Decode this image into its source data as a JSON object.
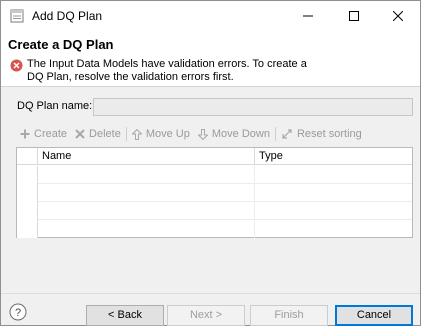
{
  "window": {
    "title": "Add DQ Plan",
    "controls": {
      "minimize_icon": "minimize-icon",
      "maximize_icon": "maximize-icon",
      "close_icon": "close-icon"
    }
  },
  "header": {
    "page_title": "Create a DQ Plan",
    "error_message": "The Input Data Models have validation errors. To create a DQ Plan, resolve the validation errors first.",
    "error_icon": "error-icon"
  },
  "form": {
    "name_label": "DQ Plan name:",
    "name_value": ""
  },
  "toolbar": {
    "items": [
      {
        "label": "Create",
        "icon": "plus-icon"
      },
      {
        "label": "Delete",
        "icon": "x-icon"
      },
      {
        "label": "Move Up",
        "icon": "arrow-up-icon"
      },
      {
        "label": "Move Down",
        "icon": "arrow-down-icon"
      },
      {
        "label": "Reset sorting",
        "icon": "reset-sort-icon"
      }
    ]
  },
  "table": {
    "columns": [
      "Name",
      "Type"
    ],
    "rows": []
  },
  "footer": {
    "help_icon": "help-icon",
    "back_label": "< Back",
    "next_label": "Next >",
    "finish_label": "Finish",
    "cancel_label": "Cancel"
  },
  "colors": {
    "accent": "#0078d7",
    "error": "#d9534f",
    "disabled_text": "#9a9a9a"
  }
}
